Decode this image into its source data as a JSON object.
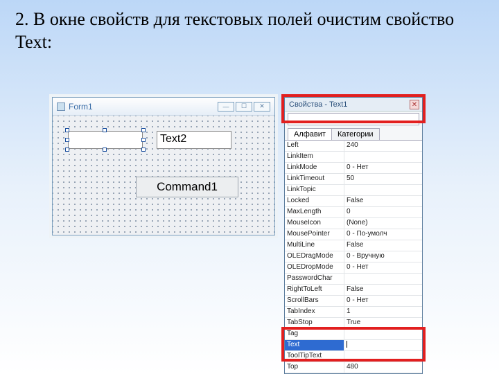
{
  "slide": {
    "title": "2. В окне свойств для текстовых полей очистим свойство Text:"
  },
  "form": {
    "caption": "Form1",
    "text2_value": "Text2",
    "command1_label": "Command1"
  },
  "properties": {
    "title": "Свойства - Text1",
    "object": "",
    "tabs": {
      "alpha": "Алфавит",
      "cat": "Категории"
    },
    "rows": [
      {
        "name": "Left",
        "value": "240"
      },
      {
        "name": "LinkItem",
        "value": ""
      },
      {
        "name": "LinkMode",
        "value": "0 - Нет"
      },
      {
        "name": "LinkTimeout",
        "value": "50"
      },
      {
        "name": "LinkTopic",
        "value": ""
      },
      {
        "name": "Locked",
        "value": "False"
      },
      {
        "name": "MaxLength",
        "value": "0"
      },
      {
        "name": "MouseIcon",
        "value": "(None)"
      },
      {
        "name": "MousePointer",
        "value": "0 - По-умолч"
      },
      {
        "name": "MultiLine",
        "value": "False"
      },
      {
        "name": "OLEDragMode",
        "value": "0 - Вручную"
      },
      {
        "name": "OLEDropMode",
        "value": "0 - Нет"
      },
      {
        "name": "PasswordChar",
        "value": ""
      },
      {
        "name": "RightToLeft",
        "value": "False"
      },
      {
        "name": "ScrollBars",
        "value": "0 - Нет"
      },
      {
        "name": "TabIndex",
        "value": "1"
      },
      {
        "name": "TabStop",
        "value": "True"
      },
      {
        "name": "Tag",
        "value": ""
      },
      {
        "name": "Text",
        "value": "",
        "selected": true
      },
      {
        "name": "ToolTipText",
        "value": ""
      },
      {
        "name": "Top",
        "value": "480"
      }
    ]
  }
}
